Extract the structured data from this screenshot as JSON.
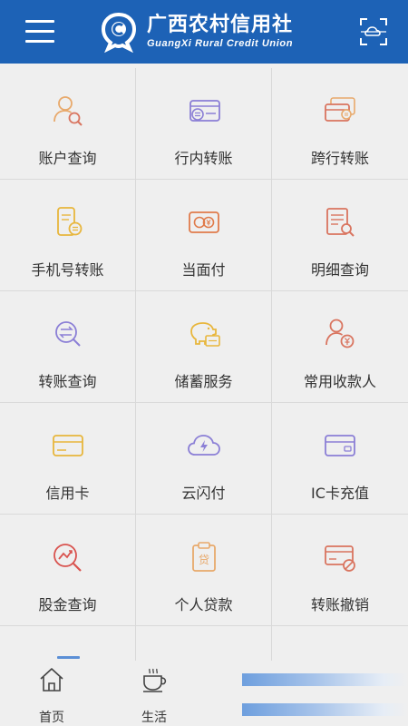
{
  "header": {
    "title_cn": "广西农村信用社",
    "title_en": "GuangXi Rural Credit Union",
    "menu_icon": "menu-icon",
    "scan_icon": "scan-icon",
    "background_color": "#1d62b6"
  },
  "services": [
    {
      "label": "账户查询",
      "icon": "account-query-icon",
      "color": "#e8a96b"
    },
    {
      "label": "行内转账",
      "icon": "intrabank-transfer-icon",
      "color": "#8b7fd6"
    },
    {
      "label": "跨行转账",
      "icon": "interbank-transfer-icon",
      "color": "#e8a96b"
    },
    {
      "label": "手机号转账",
      "icon": "phone-transfer-icon",
      "color": "#e8b63c"
    },
    {
      "label": "当面付",
      "icon": "face-pay-icon",
      "color": "#e07b4b"
    },
    {
      "label": "明细查询",
      "icon": "detail-query-icon",
      "color": "#d9745f"
    },
    {
      "label": "转账查询",
      "icon": "transfer-query-icon",
      "color": "#8b7fd6"
    },
    {
      "label": "储蓄服务",
      "icon": "savings-icon",
      "color": "#e8b63c"
    },
    {
      "label": "常用收款人",
      "icon": "payee-icon",
      "color": "#d9745f"
    },
    {
      "label": "信用卡",
      "icon": "credit-card-icon",
      "color": "#e8b63c"
    },
    {
      "label": "云闪付",
      "icon": "quickpass-icon",
      "color": "#8b7fd6"
    },
    {
      "label": "IC卡充值",
      "icon": "ic-card-icon",
      "color": "#8b7fd6"
    },
    {
      "label": "股金查询",
      "icon": "stock-query-icon",
      "color": "#d9534f"
    },
    {
      "label": "个人贷款",
      "icon": "loan-icon",
      "color": "#e8a96b"
    },
    {
      "label": "转账撤销",
      "icon": "transfer-cancel-icon",
      "color": "#d9745f"
    }
  ],
  "tabbar": {
    "home_label": "首页",
    "life_label": "生活",
    "home_icon": "home-icon",
    "life_icon": "coffee-cup-icon"
  }
}
